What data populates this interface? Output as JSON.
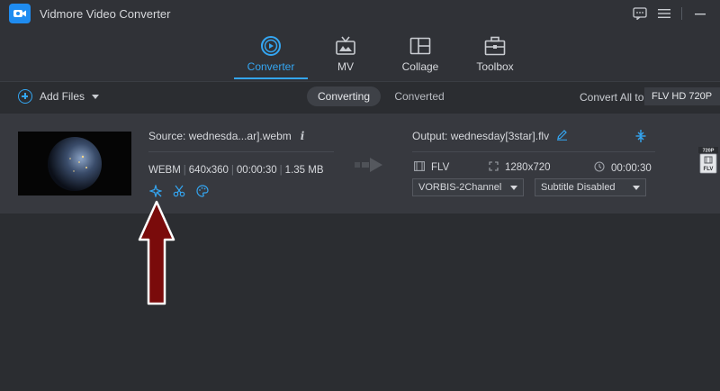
{
  "window": {
    "title": "Vidmore Video Converter"
  },
  "nav": {
    "tabs": [
      {
        "label": "Converter",
        "active": true
      },
      {
        "label": "MV",
        "active": false
      },
      {
        "label": "Collage",
        "active": false
      },
      {
        "label": "Toolbox",
        "active": false
      }
    ]
  },
  "toolbar": {
    "add_files": "Add Files",
    "segments": [
      "Converting",
      "Converted"
    ],
    "convert_all_label": "Convert All to:",
    "convert_all_value": "FLV HD 720P"
  },
  "file": {
    "source": "Source: wednesda...ar].webm",
    "format": "WEBM",
    "resolution": "640x360",
    "duration": "00:00:30",
    "size": "1.35 MB",
    "output": "Output: wednesday[3star].flv",
    "out_format": "FLV",
    "out_resolution": "1280x720",
    "out_duration": "00:00:30",
    "audio_track": "VORBIS-2Channel",
    "subtitle": "Subtitle Disabled",
    "format_badge_top": "720P",
    "format_badge_bottom": "FLV"
  },
  "colors": {
    "accent": "#34a6f2",
    "annotation_arrow": "#7a0b0b"
  }
}
